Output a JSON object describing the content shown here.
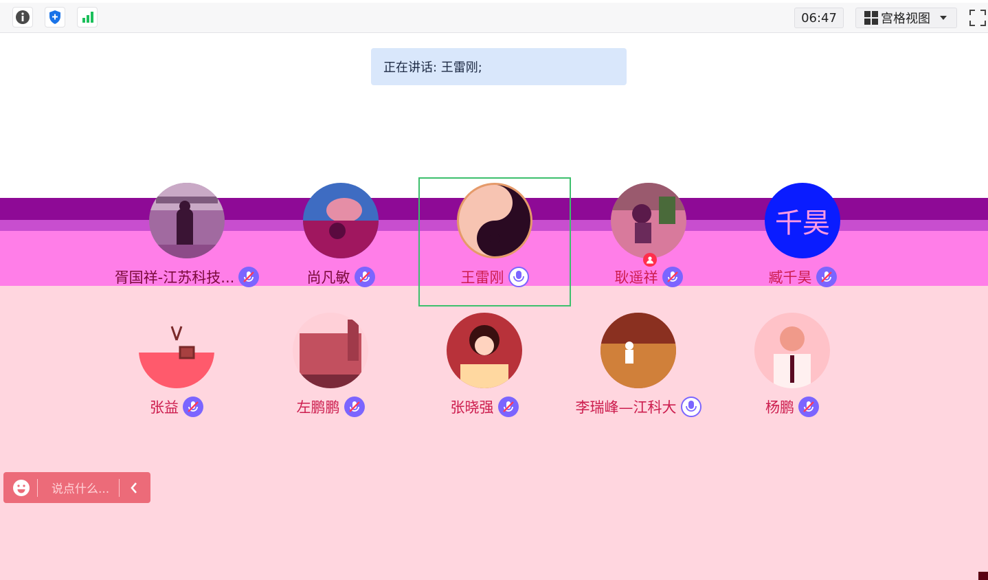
{
  "toolbar": {
    "time": "06:47",
    "view_mode_label": "宫格视图"
  },
  "speaking": {
    "text": "正在讲话: 王雷刚;"
  },
  "participants": [
    {
      "name": "胥国祥-江苏科技...",
      "mic": "muted"
    },
    {
      "name": "尚凡敏",
      "mic": "muted"
    },
    {
      "name": "王雷刚",
      "mic": "on",
      "active_speaker": true
    },
    {
      "name": "耿遥祥",
      "mic": "muted",
      "host": true
    },
    {
      "name": "臧千昊",
      "mic": "muted",
      "avatar_text": "千昊"
    },
    {
      "name": "张益",
      "mic": "muted"
    },
    {
      "name": "左鹏鹏",
      "mic": "muted"
    },
    {
      "name": "张晓强",
      "mic": "muted"
    },
    {
      "name": "李瑞峰—江科大",
      "mic": "on"
    },
    {
      "name": "杨鹏",
      "mic": "muted"
    }
  ],
  "chat": {
    "placeholder": "说点什么..."
  },
  "colors": {
    "active_border": "#3cbf6c",
    "mic_badge": "#7b65ff",
    "speaking_bg": "#d9e7fb"
  }
}
